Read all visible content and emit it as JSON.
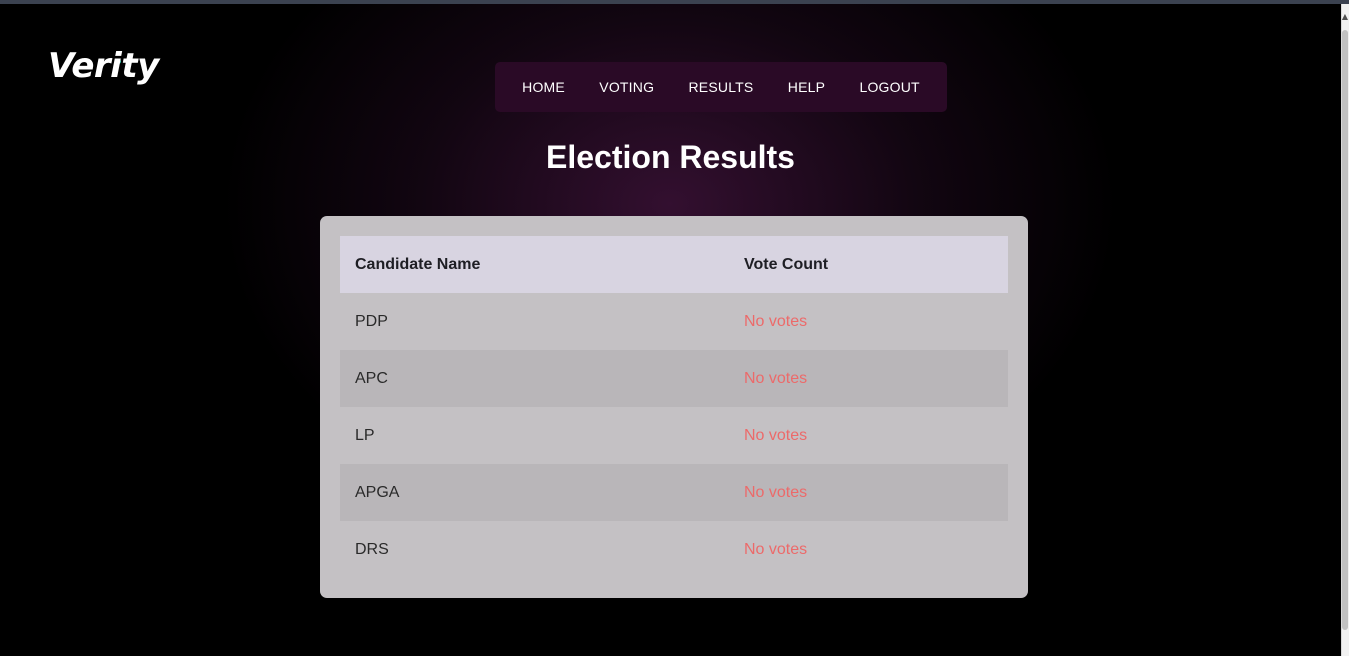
{
  "brand": {
    "name": "Verity",
    "accent": "#1fb89a"
  },
  "nav": {
    "items": [
      {
        "label": "HOME"
      },
      {
        "label": "VOTING"
      },
      {
        "label": "RESULTS"
      },
      {
        "label": "HELP"
      },
      {
        "label": "LOGOUT"
      }
    ]
  },
  "page": {
    "title": "Election Results"
  },
  "table": {
    "headers": [
      "Candidate Name",
      "Vote Count"
    ],
    "rows": [
      {
        "name": "PDP",
        "votes": "No votes"
      },
      {
        "name": "APC",
        "votes": "No votes"
      },
      {
        "name": "LP",
        "votes": "No votes"
      },
      {
        "name": "APGA",
        "votes": "No votes"
      },
      {
        "name": "DRS",
        "votes": "No votes"
      }
    ]
  },
  "colors": {
    "background": "#000000",
    "nav_background": "#2a0a26",
    "card_background": "#c4c1c4",
    "header_background": "#d8d4e1",
    "no_votes": "#ec6a6a"
  }
}
